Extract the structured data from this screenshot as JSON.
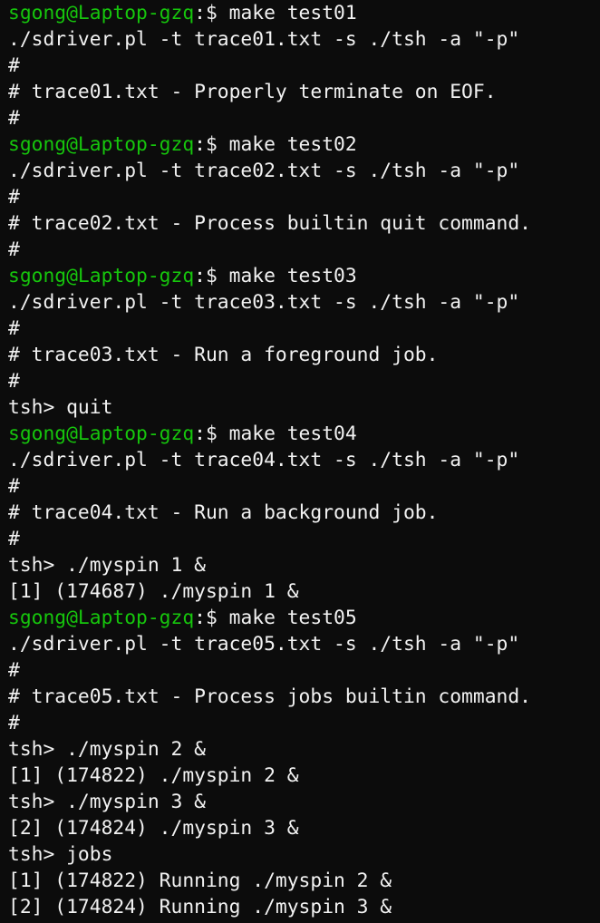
{
  "terminal": {
    "prompt_user": "sgong@Laptop-gzq",
    "prompt_suffix": ":$ ",
    "colors": {
      "background": "#0c0c0c",
      "foreground": "#f2f2f2",
      "prompt": "#16c60c"
    },
    "lines": [
      {
        "type": "prompt",
        "command": "make test01"
      },
      {
        "type": "output",
        "text": "./sdriver.pl -t trace01.txt -s ./tsh -a \"-p\""
      },
      {
        "type": "output",
        "text": "#"
      },
      {
        "type": "output",
        "text": "# trace01.txt - Properly terminate on EOF."
      },
      {
        "type": "output",
        "text": "#"
      },
      {
        "type": "prompt",
        "command": "make test02"
      },
      {
        "type": "output",
        "text": "./sdriver.pl -t trace02.txt -s ./tsh -a \"-p\""
      },
      {
        "type": "output",
        "text": "#"
      },
      {
        "type": "output",
        "text": "# trace02.txt - Process builtin quit command."
      },
      {
        "type": "output",
        "text": "#"
      },
      {
        "type": "prompt",
        "command": "make test03"
      },
      {
        "type": "output",
        "text": "./sdriver.pl -t trace03.txt -s ./tsh -a \"-p\""
      },
      {
        "type": "output",
        "text": "#"
      },
      {
        "type": "output",
        "text": "# trace03.txt - Run a foreground job."
      },
      {
        "type": "output",
        "text": "#"
      },
      {
        "type": "output",
        "text": "tsh> quit"
      },
      {
        "type": "prompt",
        "command": "make test04"
      },
      {
        "type": "output",
        "text": "./sdriver.pl -t trace04.txt -s ./tsh -a \"-p\""
      },
      {
        "type": "output",
        "text": "#"
      },
      {
        "type": "output",
        "text": "# trace04.txt - Run a background job."
      },
      {
        "type": "output",
        "text": "#"
      },
      {
        "type": "output",
        "text": "tsh> ./myspin 1 &"
      },
      {
        "type": "output",
        "text": "[1] (174687) ./myspin 1 &"
      },
      {
        "type": "prompt",
        "command": "make test05"
      },
      {
        "type": "output",
        "text": "./sdriver.pl -t trace05.txt -s ./tsh -a \"-p\""
      },
      {
        "type": "output",
        "text": "#"
      },
      {
        "type": "output",
        "text": "# trace05.txt - Process jobs builtin command."
      },
      {
        "type": "output",
        "text": "#"
      },
      {
        "type": "output",
        "text": "tsh> ./myspin 2 &"
      },
      {
        "type": "output",
        "text": "[1] (174822) ./myspin 2 &"
      },
      {
        "type": "output",
        "text": "tsh> ./myspin 3 &"
      },
      {
        "type": "output",
        "text": "[2] (174824) ./myspin 3 &"
      },
      {
        "type": "output",
        "text": "tsh> jobs"
      },
      {
        "type": "output",
        "text": "[1] (174822) Running ./myspin 2 &"
      },
      {
        "type": "output",
        "text": "[2] (174824) Running ./myspin 3 &"
      }
    ]
  }
}
